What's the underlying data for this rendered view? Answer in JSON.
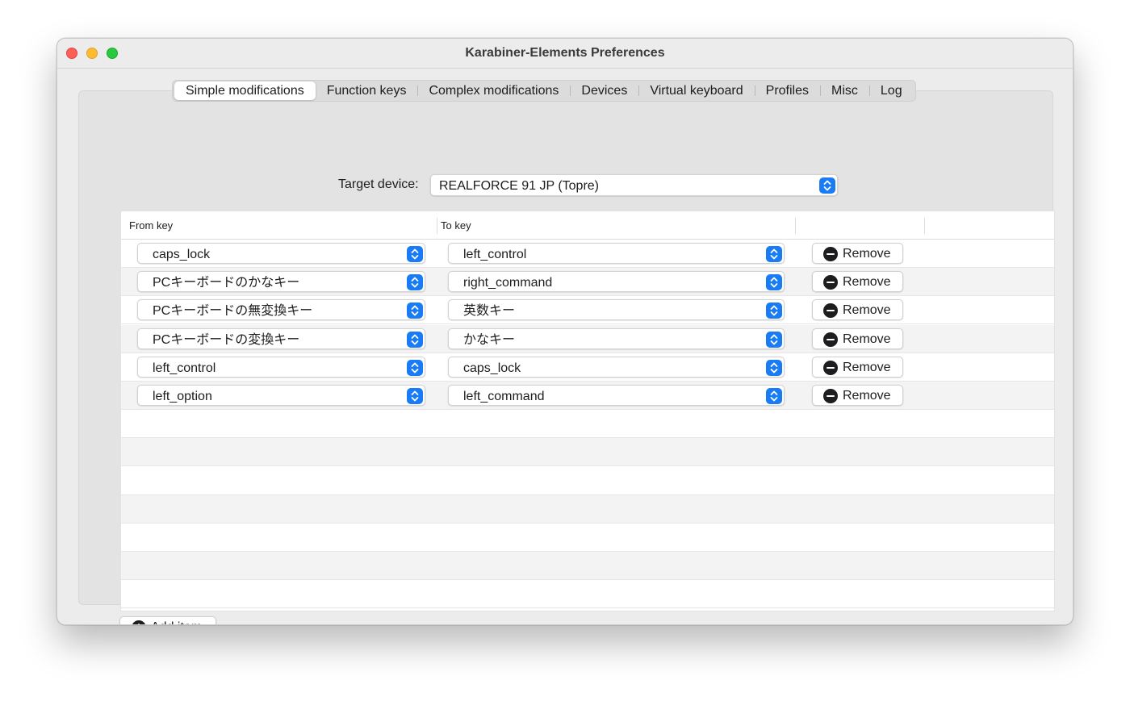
{
  "window": {
    "title": "Karabiner-Elements Preferences"
  },
  "tabs": [
    {
      "label": "Simple modifications",
      "active": true
    },
    {
      "label": "Function keys",
      "active": false
    },
    {
      "label": "Complex modifications",
      "active": false
    },
    {
      "label": "Devices",
      "active": false
    },
    {
      "label": "Virtual keyboard",
      "active": false
    },
    {
      "label": "Profiles",
      "active": false
    },
    {
      "label": "Misc",
      "active": false
    },
    {
      "label": "Log",
      "active": false
    }
  ],
  "target_device": {
    "label": "Target device:",
    "value": "REALFORCE 91 JP (Topre)"
  },
  "table": {
    "headers": {
      "from": "From key",
      "to": "To key"
    },
    "rows": [
      {
        "from": "caps_lock",
        "to": "left_control",
        "action": "Remove"
      },
      {
        "from": "PCキーボードのかなキー",
        "to": "right_command",
        "action": "Remove"
      },
      {
        "from": "PCキーボードの無変換キー",
        "to": "英数キー",
        "action": "Remove"
      },
      {
        "from": "PCキーボードの変換キー",
        "to": "かなキー",
        "action": "Remove"
      },
      {
        "from": "left_control",
        "to": "caps_lock",
        "action": "Remove"
      },
      {
        "from": "left_option",
        "to": "left_command",
        "action": "Remove"
      }
    ]
  },
  "add_item": {
    "label": "Add item"
  },
  "colors": {
    "accent": "#1a7cf5",
    "close": "#fe5f57",
    "minimize": "#febc2e",
    "maximize": "#28c840"
  },
  "icons": {
    "close": "close-icon",
    "minimize": "minimize-icon",
    "zoom": "zoom-icon",
    "stepper": "up-down-chevron-icon",
    "remove": "minus-circle-icon",
    "add": "plus-circle-icon"
  }
}
